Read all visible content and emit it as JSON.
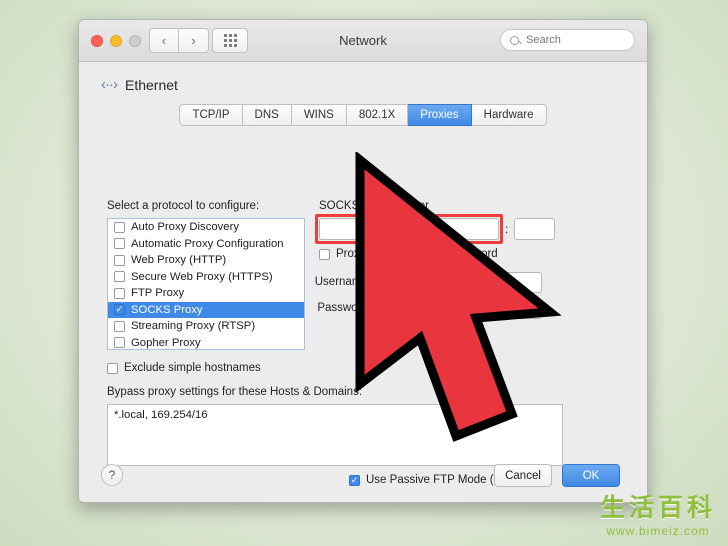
{
  "window": {
    "title": "Network",
    "search": {
      "placeholder": "Search",
      "value": ""
    },
    "nav": {
      "back": "‹",
      "forward": "›"
    },
    "grid_icon": "grid-icon",
    "traffic_lights": [
      "close",
      "minimize",
      "zoom"
    ]
  },
  "interface": {
    "icon": "ethernet-icon",
    "glyph": "‹··›",
    "name": "Ethernet"
  },
  "tabs": [
    {
      "label": "TCP/IP",
      "active": false
    },
    {
      "label": "DNS",
      "active": false
    },
    {
      "label": "WINS",
      "active": false
    },
    {
      "label": "802.1X",
      "active": false
    },
    {
      "label": "Proxies",
      "active": true
    },
    {
      "label": "Hardware",
      "active": false
    }
  ],
  "proxies": {
    "protocol_label": "Select a protocol to configure:",
    "protocols": [
      {
        "label": "Auto Proxy Discovery",
        "checked": false,
        "selected": false
      },
      {
        "label": "Automatic Proxy Configuration",
        "checked": false,
        "selected": false
      },
      {
        "label": "Web Proxy (HTTP)",
        "checked": false,
        "selected": false
      },
      {
        "label": "Secure Web Proxy (HTTPS)",
        "checked": false,
        "selected": false
      },
      {
        "label": "FTP Proxy",
        "checked": false,
        "selected": false
      },
      {
        "label": "SOCKS Proxy",
        "checked": true,
        "selected": true
      },
      {
        "label": "Streaming Proxy (RTSP)",
        "checked": false,
        "selected": false
      },
      {
        "label": "Gopher Proxy",
        "checked": false,
        "selected": false
      }
    ],
    "exclude_simple_hostnames": {
      "label": "Exclude simple hostnames",
      "checked": false
    },
    "bypass_label": "Bypass proxy settings for these Hosts & Domains:",
    "bypass_value": "*.local, 169.254/16",
    "server_title": "SOCKS Proxy Server",
    "server_value": "",
    "port_separator": ":",
    "port_value": "",
    "auth_checkbox": {
      "label": "Proxy server requires password",
      "checked": false
    },
    "username_label": "Username:",
    "username_value": "",
    "password_label": "Password:",
    "password_value": "",
    "passive_ftp": {
      "label": "Use Passive FTP Mode (PASV)",
      "checked": true
    }
  },
  "footer": {
    "help_label": "?",
    "cancel_label": "Cancel",
    "ok_label": "OK"
  },
  "annotation": {
    "highlight_color": "#ef3c3c",
    "cursor_color": "#e8353e",
    "cursor_name": "red-arrow-cursor"
  },
  "watermark": {
    "cn": "生活百科",
    "url": "www.bimeiz.com",
    "color": "#8fbf3f"
  }
}
